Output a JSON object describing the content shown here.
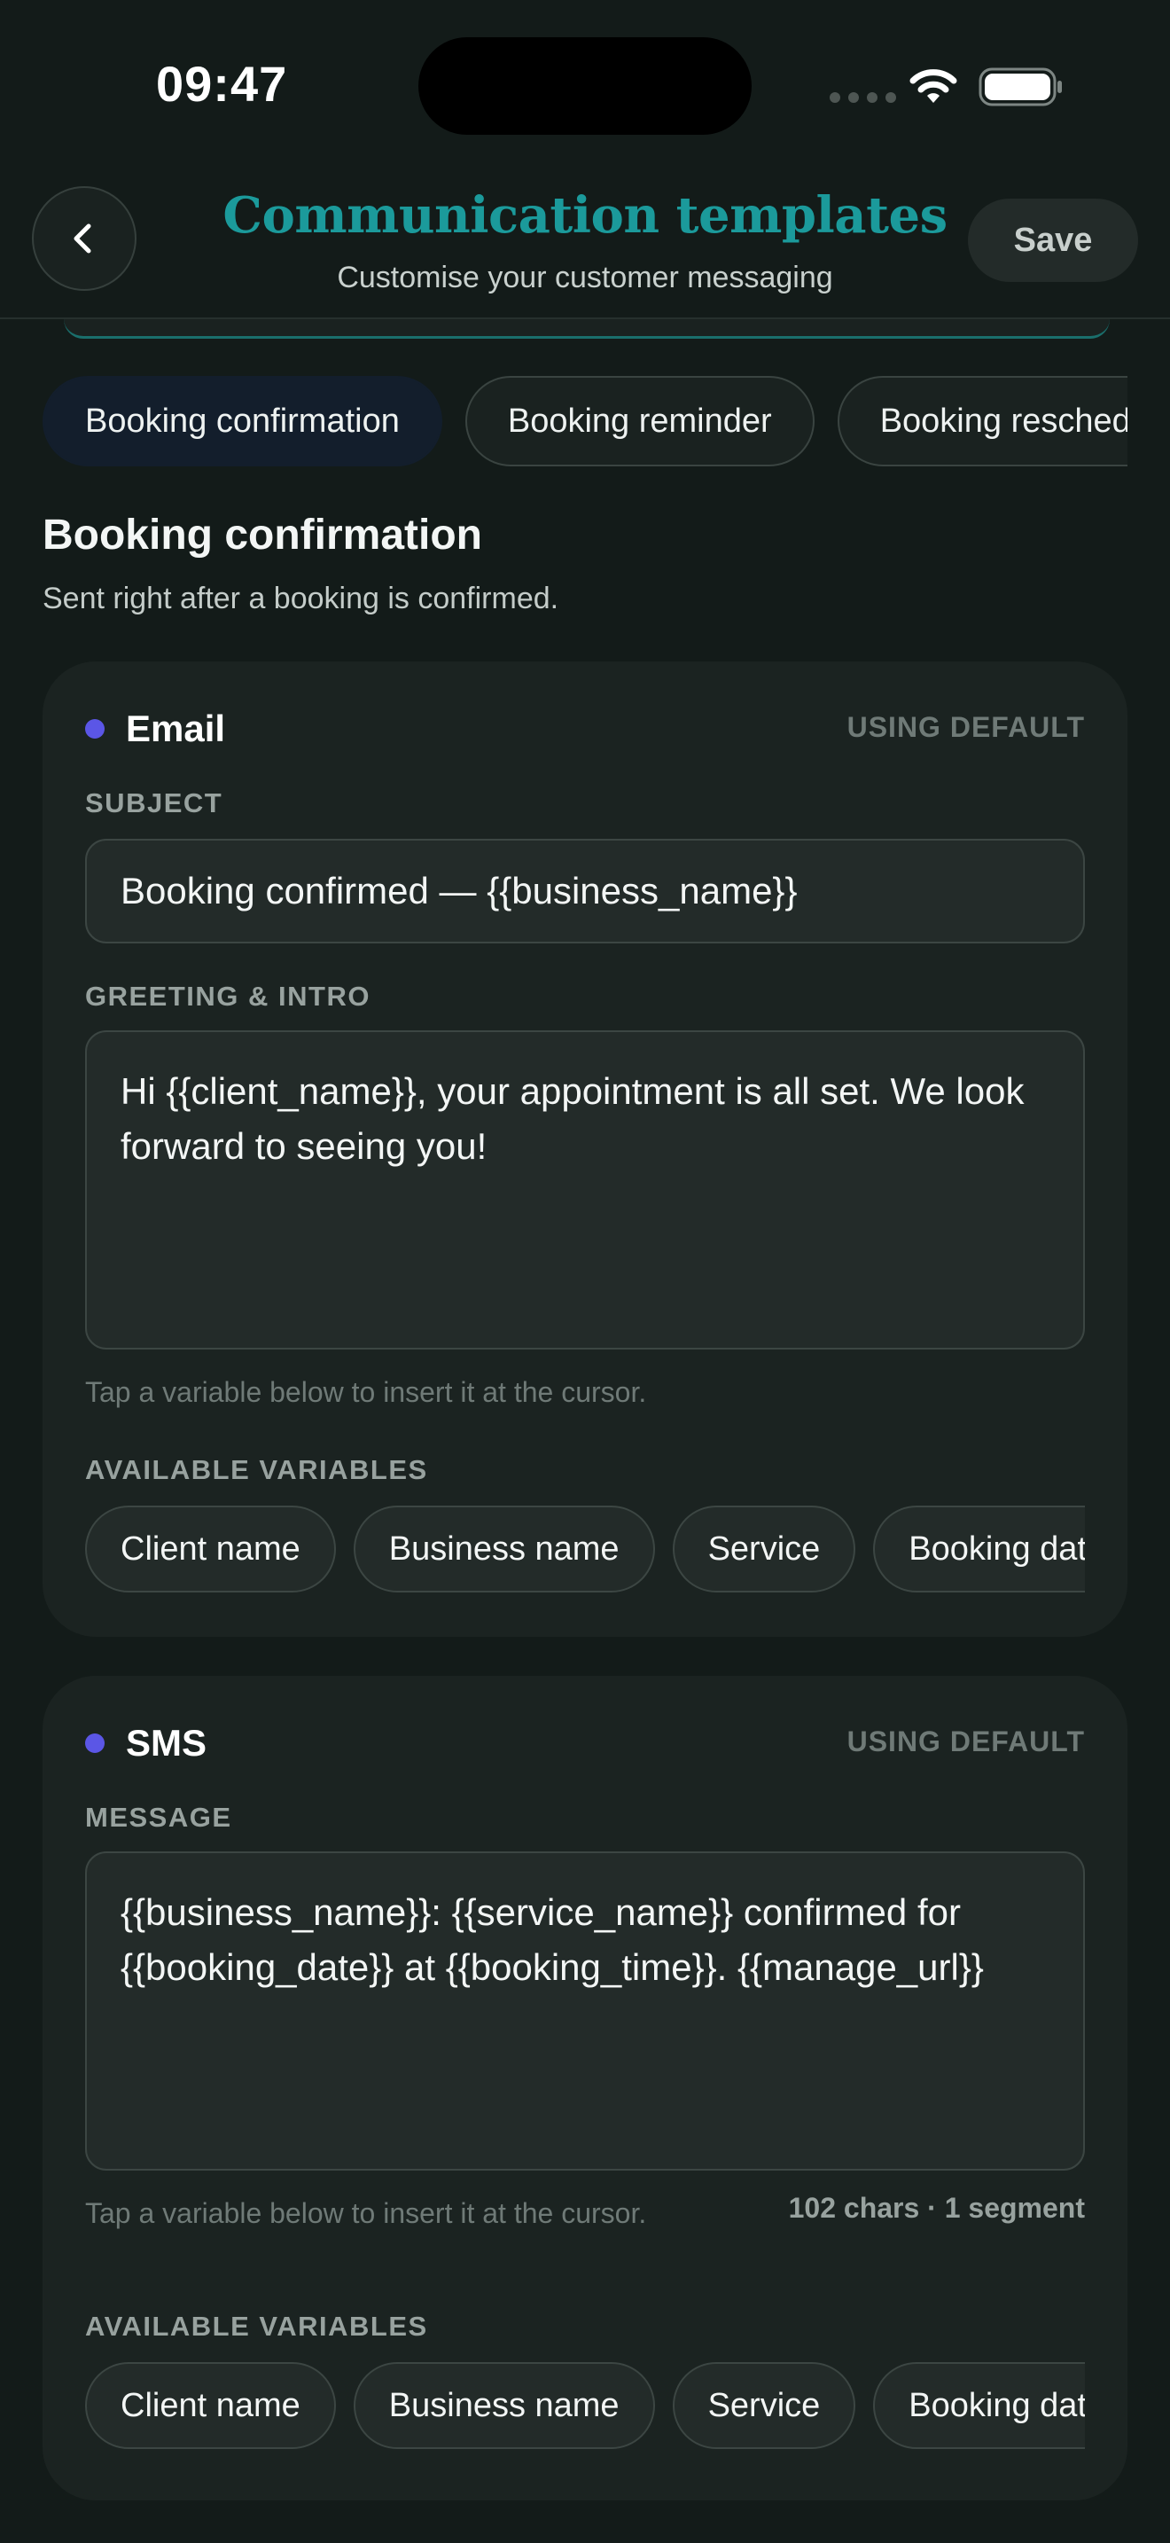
{
  "status_bar": {
    "time": "09:47"
  },
  "header": {
    "title": "Communication templates",
    "subtitle": "Customise your customer messaging",
    "save_label": "Save"
  },
  "tabs": [
    {
      "label": "Booking confirmation",
      "active": true
    },
    {
      "label": "Booking reminder",
      "active": false
    },
    {
      "label": "Booking rescheduled",
      "active": false
    }
  ],
  "section": {
    "title": "Booking confirmation",
    "description": "Sent right after a booking is confirmed."
  },
  "email": {
    "channel": "Email",
    "status": "USING DEFAULT",
    "subject_label": "SUBJECT",
    "subject_value": "Booking confirmed — {{business_name}}",
    "body_label": "GREETING & INTRO",
    "body_value": "Hi {{client_name}}, your appointment is all set. We look forward to seeing you!",
    "hint": "Tap a variable below to insert it at the cursor.",
    "variables_label": "AVAILABLE VARIABLES",
    "variables": [
      "Client name",
      "Business name",
      "Service",
      "Booking date"
    ]
  },
  "sms": {
    "channel": "SMS",
    "status": "USING DEFAULT",
    "message_label": "MESSAGE",
    "message_value": "{{business_name}}: {{service_name}} confirmed for {{booking_date}} at {{booking_time}}. {{manage_url}}",
    "hint": "Tap a variable below to insert it at the cursor.",
    "counter": "102 chars · 1 segment",
    "variables_label": "AVAILABLE VARIABLES",
    "variables": [
      "Client name",
      "Business name",
      "Service",
      "Booking date"
    ]
  },
  "colors": {
    "accent_title": "#1b9a9b",
    "channel_dot": "#5b56e6",
    "background": "#131b19",
    "card": "#1b2321"
  },
  "icons": [
    "chevron-left-icon",
    "wifi-icon",
    "battery-icon",
    "cellular-signal-icon"
  ]
}
